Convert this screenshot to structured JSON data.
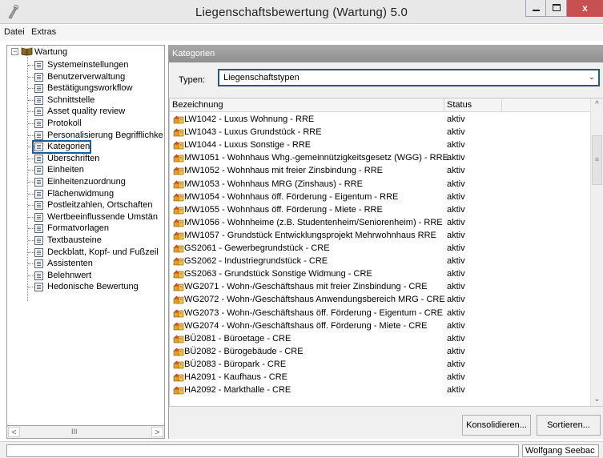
{
  "window": {
    "title": "Liegenschaftsbewertung (Wartung) 5.0",
    "minimize": "",
    "maximize": "",
    "close": "x"
  },
  "menu": [
    {
      "label": "Datei"
    },
    {
      "label": "Extras"
    }
  ],
  "tree": {
    "root": "Wartung",
    "selected_index": 6,
    "items": [
      "Systemeinstellungen",
      "Benutzerverwaltung",
      "Bestätigungsworkflow",
      "Schnittstelle",
      "Asset quality review",
      "Protokoll",
      "Personalisierung Begrifflichke",
      "Kategorien",
      "Überschriften",
      "Einheiten",
      "Einheitenzuordnung",
      "Flächenwidmung",
      "Postleitzahlen, Ortschaften",
      "Wertbeeinflussende Umstän",
      "Formatvorlagen",
      "Textbausteine",
      "Deckblatt, Kopf- und Fußzeil",
      "Assistenten",
      "Belehnwert",
      "Hedonische Bewertung"
    ]
  },
  "panel": {
    "header": "Kategorien",
    "typen_label": "Typen:",
    "typen_value": "Liegenschaftstypen"
  },
  "table": {
    "columns": [
      "Bezeichnung",
      "Status"
    ],
    "rows": [
      {
        "name": "LW1042 - Luxus Wohnung - RRE",
        "status": "aktiv"
      },
      {
        "name": "LW1043 - Luxus Grundstück - RRE",
        "status": "aktiv"
      },
      {
        "name": "LW1044 - Luxus Sonstige - RRE",
        "status": "aktiv"
      },
      {
        "name": "MW1051 - Wohnhaus Whg.-gemeinnützigkeitsgesetz (WGG) - RRE",
        "status": "aktiv"
      },
      {
        "name": "MW1052 - Wohnhaus mit freier Zinsbindung - RRE",
        "status": "aktiv"
      },
      {
        "name": "MW1053 - Wohnhaus MRG (Zinshaus) - RRE",
        "status": "aktiv"
      },
      {
        "name": "MW1054 - Wohnhaus öff. Förderung - Eigentum - RRE",
        "status": "aktiv"
      },
      {
        "name": "MW1055 - Wohnhaus öff. Förderung - Miete - RRE",
        "status": "aktiv"
      },
      {
        "name": "MW1056 - Wohnheime (z.B. Studentenheim/Seniorenheim) - RRE",
        "status": "aktiv"
      },
      {
        "name": "MW1057 - Grundstück Entwicklungsprojekt Mehrwohnhaus RRE",
        "status": "aktiv"
      },
      {
        "name": "GS2061 - Gewerbegrundstück - CRE",
        "status": "aktiv"
      },
      {
        "name": "GS2062 - Industriegrundstück - CRE",
        "status": "aktiv"
      },
      {
        "name": "GS2063 - Grundstück Sonstige Widmung - CRE",
        "status": "aktiv"
      },
      {
        "name": "WG2071 - Wohn-/Geschäftshaus mit freier Zinsbindung - CRE",
        "status": "aktiv"
      },
      {
        "name": "WG2072 - Wohn-/Geschäftshaus Anwendungsbereich MRG - CRE",
        "status": "aktiv"
      },
      {
        "name": "WG2073 - Wohn-/Geschäftshaus öff. Förderung - Eigentum - CRE",
        "status": "aktiv"
      },
      {
        "name": "WG2074 - Wohn-/Geschäftshaus öff. Förderung - Miete - CRE",
        "status": "aktiv"
      },
      {
        "name": "BÜ2081 - Büroetage - CRE",
        "status": "aktiv"
      },
      {
        "name": "BÜ2082 - Bürogebäude - CRE",
        "status": "aktiv"
      },
      {
        "name": "BÜ2083 - Büropark - CRE",
        "status": "aktiv"
      },
      {
        "name": "HA2091 - Kaufhaus - CRE",
        "status": "aktiv"
      },
      {
        "name": "HA2092 - Markthalle - CRE",
        "status": "aktiv"
      }
    ]
  },
  "buttons": {
    "konsolidieren": "Konsolidieren...",
    "sortieren": "Sortieren..."
  },
  "status": {
    "user": "Wolfgang Seebac"
  },
  "scroll": {
    "h_thumb": "III",
    "v_thumb": "≡"
  }
}
